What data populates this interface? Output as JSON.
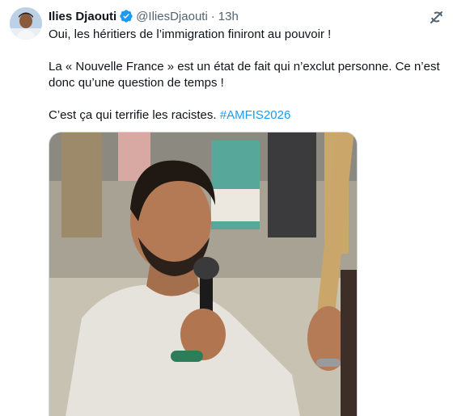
{
  "author": {
    "name": "Ilies Djaouti",
    "handle": "@IliesDjaouti",
    "separator": "·",
    "time": "13h",
    "verified_color": "#1d9bf0"
  },
  "icons": {
    "avatar": "avatar-photo",
    "verified": "verified-badge-icon",
    "grok": "grok-icon",
    "photo": "photo-man-speaking-microphone"
  },
  "tweet": {
    "line1": "Oui, les héritiers de l’immigration finiront au pouvoir !",
    "line2": "La « Nouvelle France » est un état de fait qui n’exclut personne. Ce n’est donc qu’une question de temps !",
    "line3_text": "C’est ça qui terrifie les racistes.",
    "hashtag": "#AMFIS2026"
  },
  "colors": {
    "text": "#0f1419",
    "secondary": "#536471",
    "link": "#1d9bf0"
  }
}
